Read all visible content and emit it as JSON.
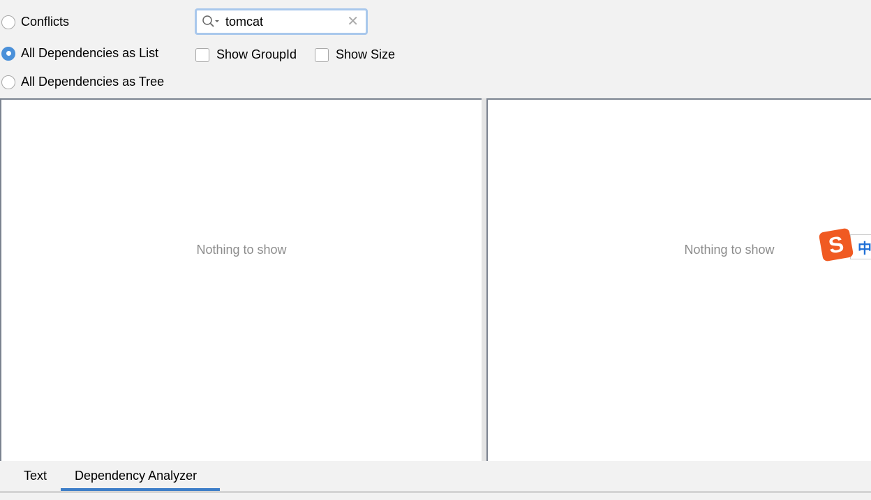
{
  "view_modes": [
    {
      "label": "Conflicts",
      "selected": false
    },
    {
      "label": "All Dependencies as List",
      "selected": true
    },
    {
      "label": "All Dependencies as Tree",
      "selected": false
    }
  ],
  "search": {
    "value": "tomcat",
    "icon": "search-icon",
    "clear_icon": "close-icon"
  },
  "options": [
    {
      "label": "Show GroupId",
      "checked": false
    },
    {
      "label": "Show Size",
      "checked": false
    }
  ],
  "left_panel": {
    "empty_text": "Nothing to show"
  },
  "right_panel": {
    "empty_text": "Nothing to show"
  },
  "ime": {
    "logo": "S",
    "mode": "中"
  },
  "tabs": [
    {
      "label": "Text",
      "active": false
    },
    {
      "label": "Dependency Analyzer",
      "active": true
    }
  ],
  "colors": {
    "accent": "#3d7ec8",
    "selected_radio": "#4a90d9",
    "ime_orange": "#f05a22"
  }
}
